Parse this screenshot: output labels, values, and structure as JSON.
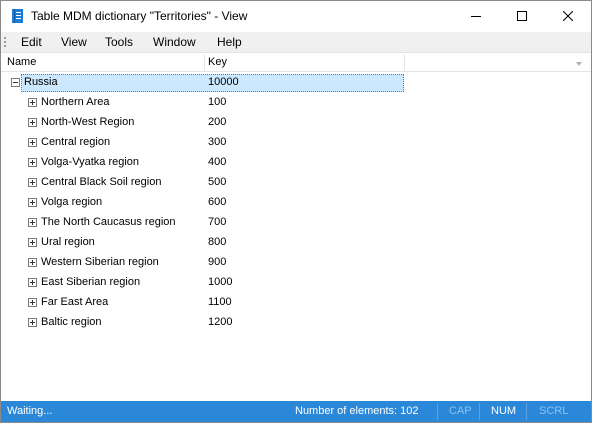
{
  "window": {
    "title": "Table MDM dictionary \"Territories\" - View",
    "icon": "dictionary-icon",
    "controls": {
      "minimize": "minimize-icon",
      "maximize": "maximize-icon",
      "close": "close-icon"
    }
  },
  "menu": {
    "items": [
      "Edit",
      "View",
      "Tools",
      "Window",
      "Help"
    ]
  },
  "grid": {
    "columns": {
      "name": "Name",
      "key": "Key"
    },
    "root": {
      "name": "Russia",
      "key": "10000",
      "expanded": true,
      "selected": true
    },
    "children": [
      {
        "name": "Northern Area",
        "key": "100"
      },
      {
        "name": "North-West Region",
        "key": "200"
      },
      {
        "name": "Central region",
        "key": "300"
      },
      {
        "name": "Volga-Vyatka region",
        "key": "400"
      },
      {
        "name": "Central Black Soil region",
        "key": "500"
      },
      {
        "name": "Volga region",
        "key": "600"
      },
      {
        "name": "The North Caucasus region",
        "key": "700"
      },
      {
        "name": "Ural region",
        "key": "800"
      },
      {
        "name": "Western Siberian region",
        "key": "900"
      },
      {
        "name": "East Siberian region",
        "key": "1000"
      },
      {
        "name": "Far East Area",
        "key": "1100"
      },
      {
        "name": "Baltic region",
        "key": "1200"
      }
    ]
  },
  "status": {
    "message": "Waiting...",
    "count": "Number of elements: 102",
    "cap": "CAP",
    "num": "NUM",
    "scrl": "SCRL"
  },
  "colors": {
    "status_bar": "#2b88d8",
    "selection": "#cce8ff"
  }
}
